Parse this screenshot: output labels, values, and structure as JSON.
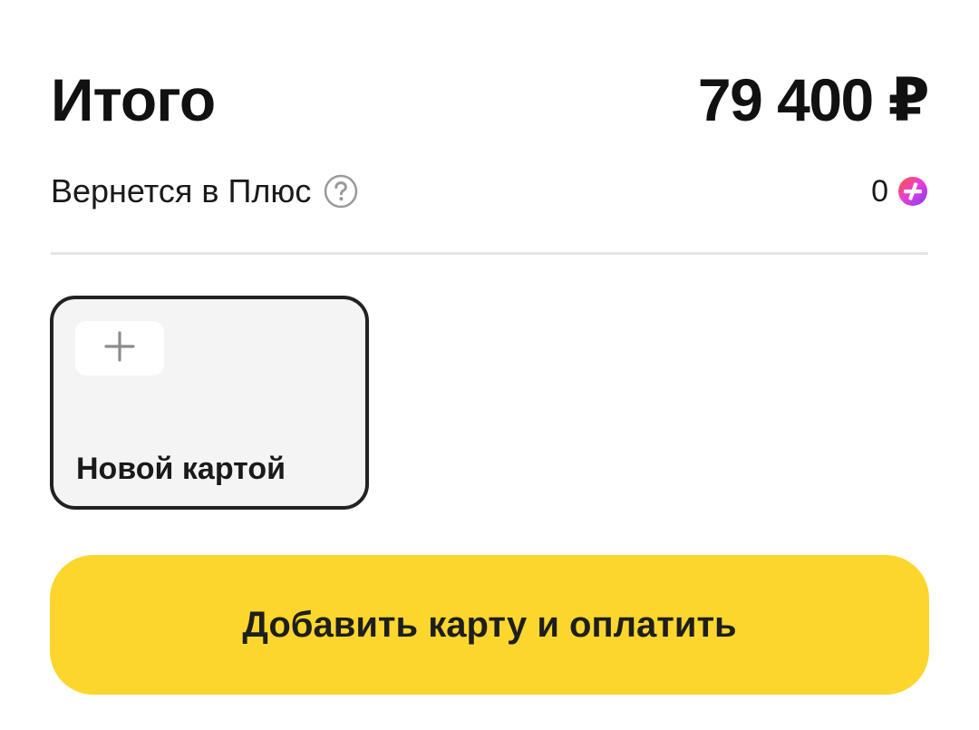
{
  "total": {
    "label": "Итого",
    "amount": "79 400 ₽"
  },
  "plus": {
    "label": "Вернется в Плюс",
    "help_icon": "question-circle-icon",
    "value": "0",
    "badge_icon": "plus-points-icon"
  },
  "payment_methods": [
    {
      "icon": "plus-icon",
      "label": "Новой картой",
      "selected": true
    }
  ],
  "pay_button": {
    "label": "Добавить карту и оплатить"
  },
  "colors": {
    "accent_yellow": "#fcd62d",
    "text_primary": "#111111",
    "card_background": "#f4f4f4",
    "card_border": "#222222",
    "divider": "#e6e6e6",
    "plus_gradient_start": "#ff5a2c",
    "plus_gradient_mid": "#e63ce0",
    "plus_gradient_end": "#7b3ff2"
  }
}
